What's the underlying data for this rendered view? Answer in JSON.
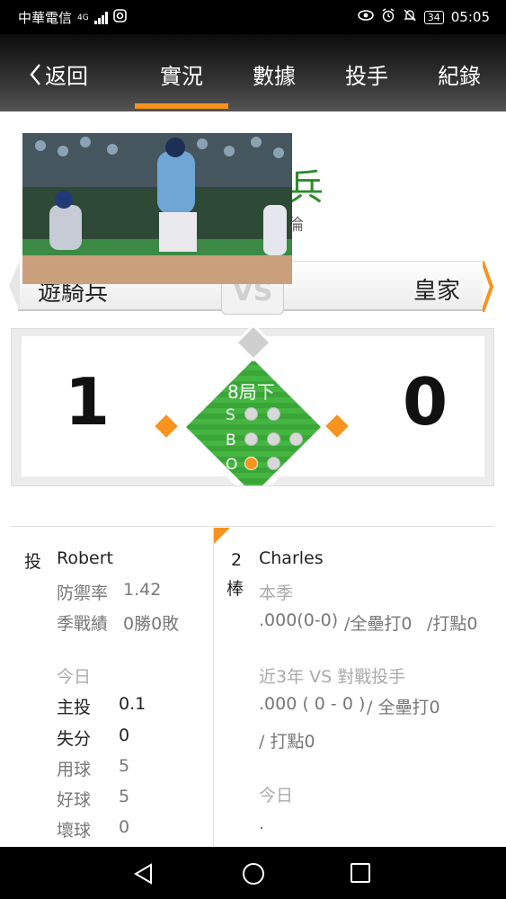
{
  "status_bar": {
    "carrier": "中華電信",
    "network": "4G",
    "battery": "34",
    "time": "05:05"
  },
  "nav": {
    "back_label": "返回",
    "tabs": [
      "實況",
      "數據",
      "投手",
      "紀錄"
    ],
    "active_tab": "實況"
  },
  "matchup": {
    "away_team": "遊騎兵",
    "home_team": "皇家",
    "vs": "VS",
    "green_partial_text": "兵",
    "sub_partial_text": "倫"
  },
  "scoreboard": {
    "away_score": "1",
    "home_score": "0",
    "inning": "8局下",
    "count_labels": [
      "S",
      "B",
      "O"
    ],
    "strikes": 0,
    "balls": 0,
    "outs": 1
  },
  "pitcher": {
    "role": "投",
    "name": "Robert",
    "era_label": "防禦率",
    "era": "1.42",
    "record_label": "季戰績",
    "record": "0勝0敗",
    "today_label": "今日",
    "stats": [
      {
        "label": "主投",
        "value": "0.1"
      },
      {
        "label": "失分",
        "value": "0"
      },
      {
        "label": "用球",
        "value": "5"
      },
      {
        "label": "好球",
        "value": "5"
      },
      {
        "label": "壞球",
        "value": "0"
      }
    ]
  },
  "batter": {
    "order_num": "2",
    "order_label": "棒",
    "name": "Charles",
    "season_label": "本季",
    "season_line_avg": ".000(0-0)",
    "season_line_hr": "/全壘打0",
    "season_line_rbi": "/打點0",
    "vs_label": "近3年 VS 對戰投手",
    "vs_line_avg": ".000 ( 0 - 0 )",
    "vs_line_hr": "/ 全壘打0",
    "vs_line_rbi": "/ 打點0",
    "today_label": "今日",
    "today_value": "."
  },
  "colors": {
    "accent": "#f7931e",
    "field_green": "#3aa637",
    "header_dark": "#111111"
  }
}
